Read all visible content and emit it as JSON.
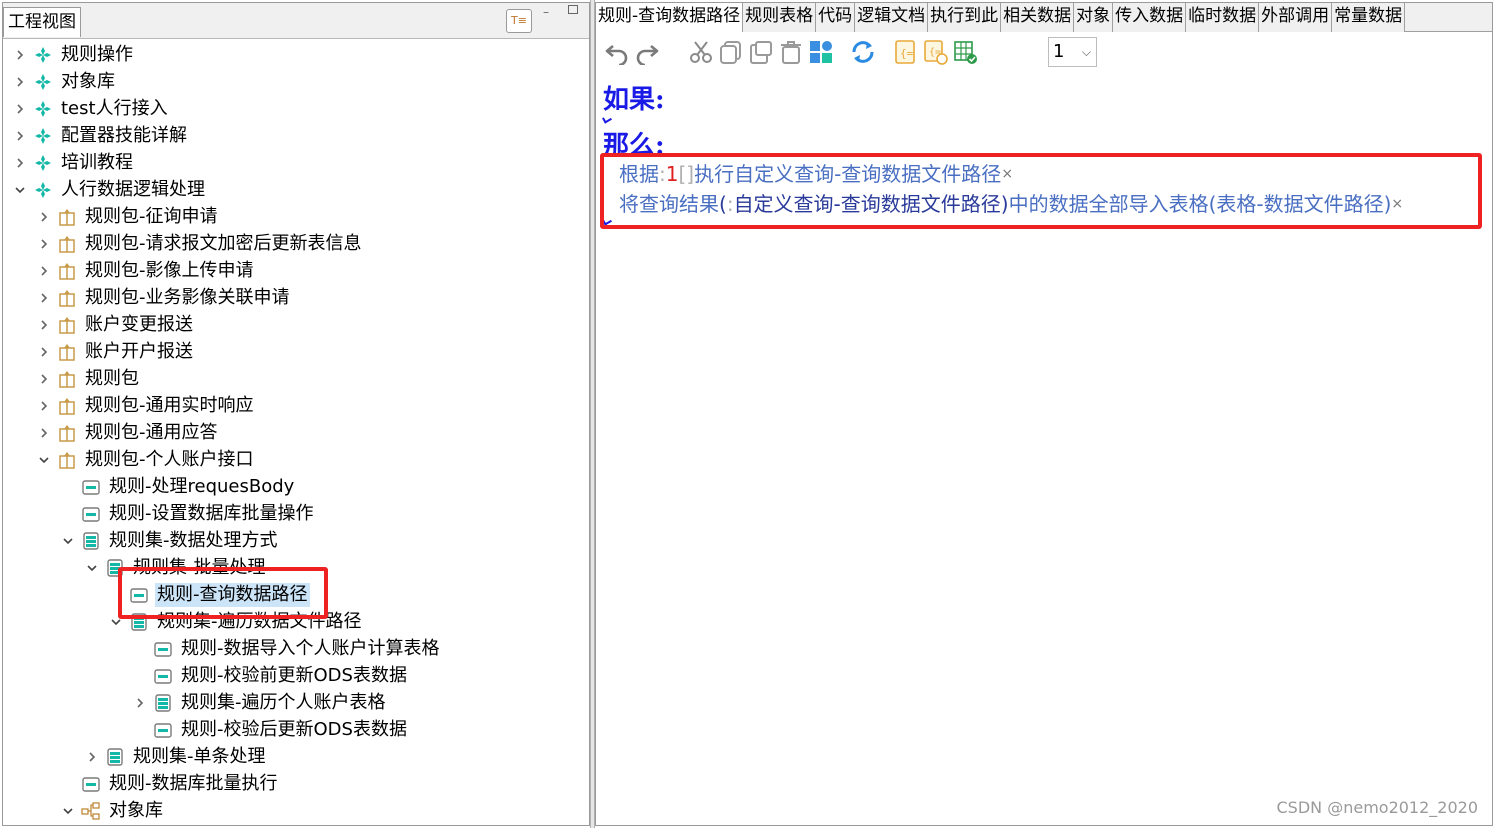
{
  "left_panel": {
    "title": "工程视图",
    "toggle_icon": "T≡",
    "minimize": "–"
  },
  "tree": [
    {
      "label": "规则操作",
      "expanded": false,
      "icon": "package-icon"
    },
    {
      "label": "对象库",
      "expanded": false,
      "icon": "package-icon"
    },
    {
      "label": "test人行接入",
      "expanded": false,
      "icon": "package-icon"
    },
    {
      "label": "配置器技能详解",
      "expanded": false,
      "icon": "package-icon"
    },
    {
      "label": "培训教程",
      "expanded": false,
      "icon": "package-icon"
    },
    {
      "label": "人行数据逻辑处理",
      "expanded": true,
      "icon": "package-icon"
    },
    {
      "label": "规则包-征询申请",
      "expanded": false,
      "icon": "rule-package-icon"
    },
    {
      "label": "规则包-请求报文加密后更新表信息",
      "expanded": false,
      "icon": "rule-package-icon"
    },
    {
      "label": "规则包-影像上传申请",
      "expanded": false,
      "icon": "rule-package-icon"
    },
    {
      "label": "规则包-业务影像关联申请",
      "expanded": false,
      "icon": "rule-package-icon"
    },
    {
      "label": "账户变更报送",
      "expanded": false,
      "icon": "rule-package-icon"
    },
    {
      "label": "账户开户报送",
      "expanded": false,
      "icon": "rule-package-icon"
    },
    {
      "label": "规则包",
      "expanded": false,
      "icon": "rule-package-icon"
    },
    {
      "label": "规则包-通用实时响应",
      "expanded": false,
      "icon": "rule-package-icon"
    },
    {
      "label": "规则包-通用应答",
      "expanded": false,
      "icon": "rule-package-icon"
    },
    {
      "label": "规则包-个人账户接口",
      "expanded": true,
      "icon": "rule-package-icon"
    },
    {
      "label": "规则-处理requesBody",
      "expanded": null,
      "icon": "rule-icon"
    },
    {
      "label": "规则-设置数据库批量操作",
      "expanded": null,
      "icon": "rule-icon"
    },
    {
      "label": "规则集-数据处理方式",
      "expanded": true,
      "icon": "ruleset-icon"
    },
    {
      "label": "规则集-批量处理",
      "expanded": true,
      "icon": "ruleset-icon"
    },
    {
      "label": "规则-查询数据路径",
      "expanded": null,
      "icon": "rule-icon",
      "selected": true
    },
    {
      "label": "规则集-遍历数据文件路径",
      "expanded": true,
      "icon": "ruleset-icon"
    },
    {
      "label": "规则-数据导入个人账户计算表格",
      "expanded": null,
      "icon": "rule-icon"
    },
    {
      "label": "规则-校验前更新ODS表数据",
      "expanded": null,
      "icon": "rule-icon"
    },
    {
      "label": "规则集-遍历个人账户表格",
      "expanded": false,
      "icon": "ruleset-icon"
    },
    {
      "label": "规则-校验后更新ODS表数据",
      "expanded": null,
      "icon": "rule-icon"
    },
    {
      "label": "规则集-单条处理",
      "expanded": false,
      "icon": "ruleset-icon"
    },
    {
      "label": "规则-数据库批量执行",
      "expanded": null,
      "icon": "rule-icon"
    },
    {
      "label": "对象库",
      "expanded": true,
      "icon": "object-library-icon"
    }
  ],
  "tabs": [
    "规则-查询数据路径",
    "规则表格",
    "代码",
    "逻辑文档",
    "执行到此",
    "相关数据",
    "对象",
    "传入数据",
    "临时数据",
    "外部调用",
    "常量数据"
  ],
  "toolbar": {
    "page_value": "1",
    "chevron": "⌵"
  },
  "editor": {
    "if_keyword": "如果:",
    "then_keyword": "那么:",
    "line1": {
      "prefix": "根据",
      "colon": ":",
      "number": "1",
      "bracket": "[]",
      "text": "执行自定义查询-查询数据文件路径",
      "close": "×"
    },
    "line2": {
      "prefix": "将查询结果",
      "open": "(",
      "colon": ":",
      "text": "自定义查询-查询数据文件路径",
      "close_paren": ")",
      "middle": "中的数据全部导入表格",
      "table": "(表格-数据文件路径)",
      "close": "×"
    }
  },
  "watermark": "CSDN @nemo2012_2020",
  "colors": {
    "keyword": "#1a1ae6",
    "highlight": "#ee2222",
    "selection": "#cce4f7",
    "teal": "#14b8a6"
  }
}
